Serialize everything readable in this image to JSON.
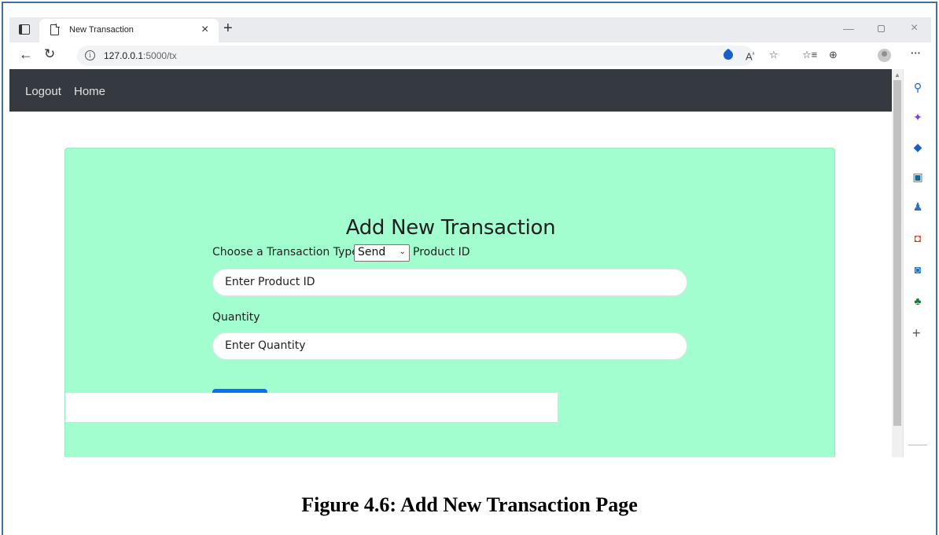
{
  "browser": {
    "tab_title": "New Transaction",
    "tab_close": "×",
    "new_tab": "+",
    "window_min": "—",
    "window_close": "×",
    "url_host": "127.0.0.1",
    "url_rest": ":5000/tx",
    "toolbar_more": "···"
  },
  "navbar": {
    "logout": "Logout",
    "home": "Home"
  },
  "form": {
    "title": "Add New Transaction",
    "type_label": "Choose a Transaction Type:",
    "type_selected": "Send",
    "product_label": "Product ID",
    "product_placeholder": "Enter Product ID",
    "quantity_label": "Quantity",
    "quantity_placeholder": "Enter Quantity"
  },
  "sidebar_icons": [
    "search-icon",
    "copilot-icon",
    "shopping-icon",
    "tools-icon",
    "games-icon",
    "office-icon",
    "outlook-icon",
    "drop-icon"
  ],
  "colors": {
    "navbar": "#343a40",
    "card": "#a3fecf",
    "submit": "#0d6efd"
  },
  "caption": "Figure 4.6: Add New Transaction Page"
}
